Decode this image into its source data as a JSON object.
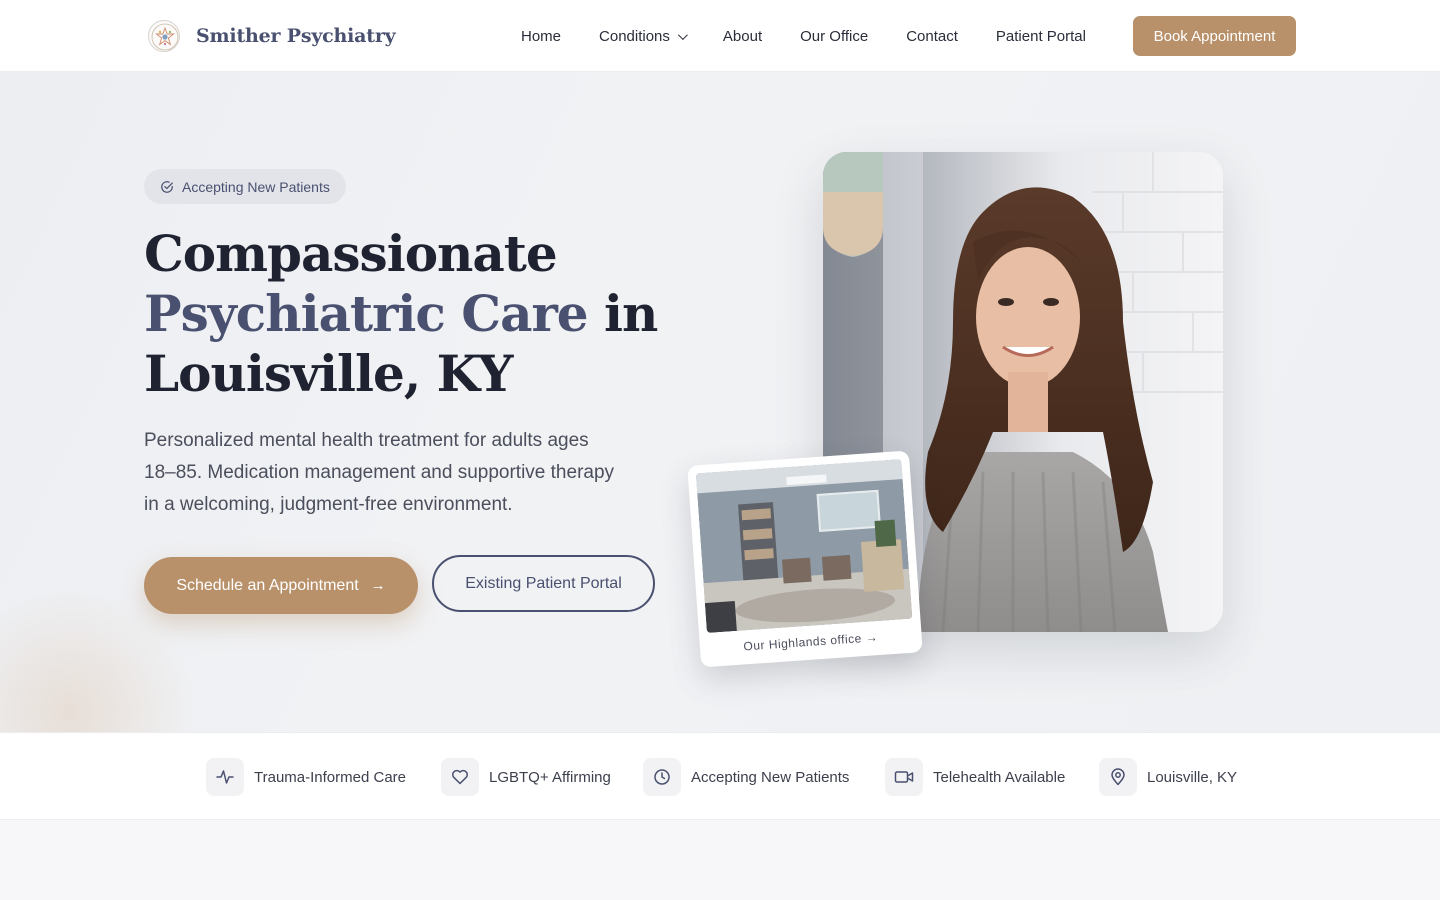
{
  "brand": {
    "name": "Smither Psychiatry"
  },
  "nav": {
    "items": [
      {
        "label": "Home"
      },
      {
        "label": "Conditions"
      },
      {
        "label": "About"
      },
      {
        "label": "Our Office"
      },
      {
        "label": "Contact"
      },
      {
        "label": "Patient Portal"
      }
    ],
    "cta": "Book Appointment"
  },
  "hero": {
    "badge": "Accepting New Patients",
    "headline_line1": "Compassionate",
    "headline_accent": "Psychiatric Care",
    "headline_line2_rest": "in",
    "headline_line3": "Louisville, KY",
    "lead": "Personalized mental health treatment for adults ages 18–85. Medication management and supportive therapy in a welcoming, judgment-free environment.",
    "primary_button": "Schedule an Appointment",
    "secondary_button": "Existing Patient Portal",
    "polaroid_caption": "Our Highlands office →"
  },
  "features": [
    {
      "label": "Trauma-Informed Care",
      "icon": "activity-icon"
    },
    {
      "label": "LGBTQ+ Affirming",
      "icon": "heart-icon"
    },
    {
      "label": "Accepting New Patients",
      "icon": "clock-icon"
    },
    {
      "label": "Telehealth Available",
      "icon": "video-icon"
    },
    {
      "label": "Louisville, KY",
      "icon": "map-pin-icon"
    }
  ],
  "colors": {
    "accent": "#b8916a",
    "navy": "#4a5170"
  }
}
